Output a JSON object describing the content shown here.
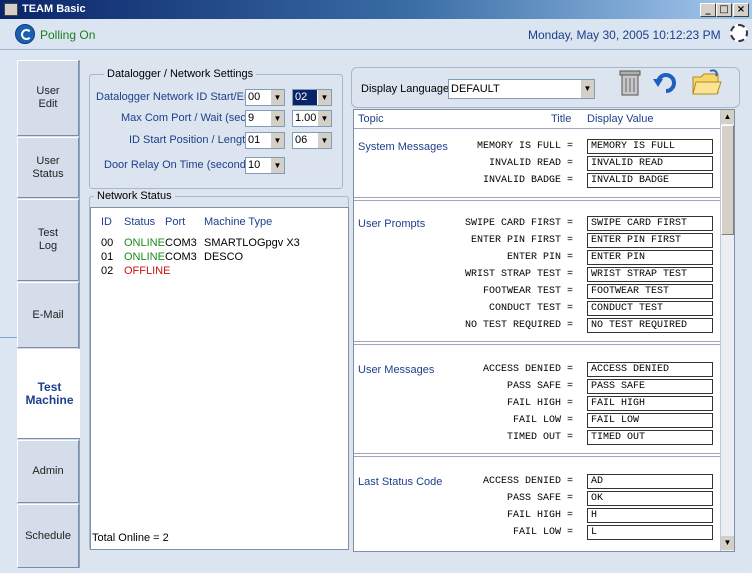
{
  "window": {
    "title": "TEAM Basic",
    "controls": [
      "_",
      "□",
      "×"
    ]
  },
  "status": {
    "polling": "Polling On",
    "datetime": "Monday, May 30, 2005   10:12:23 PM"
  },
  "nav": [
    {
      "label": "User\nEdit"
    },
    {
      "label": "User\nStatus"
    },
    {
      "label": "Test\nLog"
    },
    {
      "label": "E-Mail"
    },
    {
      "label": "Test\nMachine"
    },
    {
      "label": "Admin"
    },
    {
      "label": "Schedule"
    }
  ],
  "settings": {
    "group_title": "Datalogger / Network Settings",
    "rows": [
      {
        "label": "Datalogger Network ID Start/End",
        "v1": "00",
        "v2": "02"
      },
      {
        "label": "Max Com Port / Wait (sec)",
        "v1": "9",
        "v2": "1.00"
      },
      {
        "label": "ID Start Position / Length",
        "v1": "01",
        "v2": "06"
      },
      {
        "label": "Door Relay On Time (seconds)",
        "v1": "10"
      }
    ]
  },
  "network": {
    "group_title": "Network Status",
    "headers": [
      "ID",
      "Status",
      "Port",
      "Machine Type"
    ],
    "rows": [
      {
        "id": "00",
        "status": "ONLINE",
        "port": "COM3",
        "type": "SMARTLOGpgv X3"
      },
      {
        "id": "01",
        "status": "ONLINE",
        "port": "COM3",
        "type": "DESCO"
      },
      {
        "id": "02",
        "status": "OFFLINE",
        "port": "",
        "type": ""
      }
    ],
    "total": "Total Online = 2"
  },
  "display": {
    "language_label": "Display Language",
    "language_value": "DEFAULT",
    "headers": [
      "Topic",
      "Title",
      "Display Value"
    ],
    "sections": [
      {
        "topic": "System Messages",
        "rows": [
          {
            "title": "MEMORY IS FULL =",
            "value": "MEMORY IS FULL"
          },
          {
            "title": "INVALID READ =",
            "value": "INVALID READ"
          },
          {
            "title": "INVALID BADGE =",
            "value": "INVALID BADGE"
          }
        ]
      },
      {
        "topic": "User Prompts",
        "rows": [
          {
            "title": "SWIPE CARD FIRST =",
            "value": "SWIPE CARD FIRST"
          },
          {
            "title": "ENTER PIN FIRST =",
            "value": "ENTER PIN FIRST"
          },
          {
            "title": "ENTER PIN =",
            "value": "ENTER PIN"
          },
          {
            "title": "WRIST STRAP TEST =",
            "value": "WRIST STRAP TEST"
          },
          {
            "title": "FOOTWEAR TEST =",
            "value": "FOOTWEAR TEST"
          },
          {
            "title": "CONDUCT TEST =",
            "value": "CONDUCT TEST"
          },
          {
            "title": "NO TEST REQUIRED =",
            "value": "NO TEST REQUIRED"
          }
        ]
      },
      {
        "topic": "User Messages",
        "rows": [
          {
            "title": "ACCESS DENIED =",
            "value": "ACCESS DENIED"
          },
          {
            "title": "PASS SAFE =",
            "value": "PASS SAFE"
          },
          {
            "title": "FAIL HIGH =",
            "value": "FAIL HIGH"
          },
          {
            "title": "FAIL LOW =",
            "value": "FAIL LOW"
          },
          {
            "title": "TIMED OUT =",
            "value": "TIMED OUT"
          }
        ]
      },
      {
        "topic": "Last Status Code",
        "rows": [
          {
            "title": "ACCESS DENIED =",
            "value": "AD"
          },
          {
            "title": "PASS SAFE =",
            "value": "OK"
          },
          {
            "title": "FAIL HIGH =",
            "value": "H"
          },
          {
            "title": "FAIL LOW =",
            "value": "L"
          }
        ]
      }
    ]
  },
  "toolbar": {
    "icons": [
      "trash-icon",
      "undo-icon",
      "open-folder-icon"
    ]
  }
}
